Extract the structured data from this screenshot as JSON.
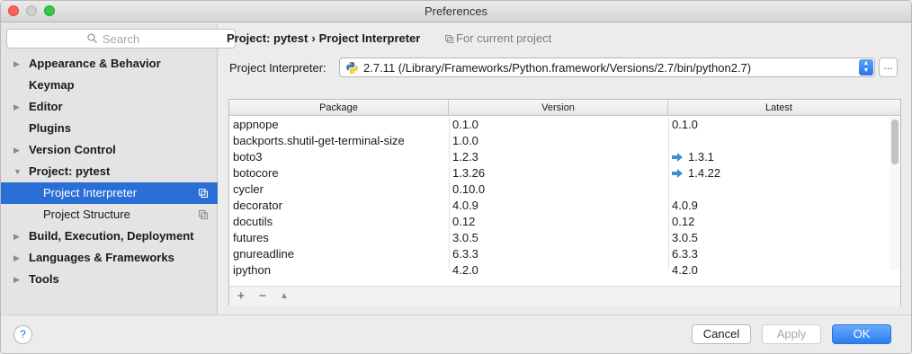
{
  "window": {
    "title": "Preferences"
  },
  "search": {
    "placeholder": "Search"
  },
  "sidebar": {
    "items": [
      {
        "label": "Appearance & Behavior",
        "arrow": "▶"
      },
      {
        "label": "Keymap",
        "arrow": ""
      },
      {
        "label": "Editor",
        "arrow": "▶"
      },
      {
        "label": "Plugins",
        "arrow": ""
      },
      {
        "label": "Version Control",
        "arrow": "▶"
      },
      {
        "label": "Project: pytest",
        "arrow": "▼"
      },
      {
        "label": "Project Interpreter",
        "arrow": ""
      },
      {
        "label": "Project Structure",
        "arrow": ""
      },
      {
        "label": "Build, Execution, Deployment",
        "arrow": "▶"
      },
      {
        "label": "Languages & Frameworks",
        "arrow": "▶"
      },
      {
        "label": "Tools",
        "arrow": "▶"
      }
    ]
  },
  "header": {
    "breadcrumb_parent": "Project: pytest",
    "breadcrumb_sep": "›",
    "breadcrumb_current": "Project Interpreter",
    "scope": "For current project"
  },
  "interpreter": {
    "label": "Project Interpreter:",
    "value": "2.7.11 (/Library/Frameworks/Python.framework/Versions/2.7/bin/python2.7)",
    "more_label": "..."
  },
  "table": {
    "headers": [
      "Package",
      "Version",
      "Latest"
    ],
    "rows": [
      {
        "package": "appnope",
        "version": "0.1.0",
        "latest": "0.1.0",
        "upgrade": false
      },
      {
        "package": "backports.shutil-get-terminal-size",
        "version": "1.0.0",
        "latest": "",
        "upgrade": false
      },
      {
        "package": "boto3",
        "version": "1.2.3",
        "latest": "1.3.1",
        "upgrade": true
      },
      {
        "package": "botocore",
        "version": "1.3.26",
        "latest": "1.4.22",
        "upgrade": true
      },
      {
        "package": "cycler",
        "version": "0.10.0",
        "latest": "",
        "upgrade": false
      },
      {
        "package": "decorator",
        "version": "4.0.9",
        "latest": "4.0.9",
        "upgrade": false
      },
      {
        "package": "docutils",
        "version": "0.12",
        "latest": "0.12",
        "upgrade": false
      },
      {
        "package": "futures",
        "version": "3.0.5",
        "latest": "3.0.5",
        "upgrade": false
      },
      {
        "package": "gnureadline",
        "version": "6.3.3",
        "latest": "6.3.3",
        "upgrade": false
      },
      {
        "package": "ipython",
        "version": "4.2.0",
        "latest": "4.2.0",
        "upgrade": false
      }
    ]
  },
  "table_toolbar": {
    "add": "+",
    "remove": "−",
    "upgrade": "▲"
  },
  "footer": {
    "help_label": "?",
    "cancel_label": "Cancel",
    "apply_label": "Apply",
    "ok_label": "OK"
  },
  "colors": {
    "selection": "#2a6fd6",
    "upgrade_arrow": "#3c8fd6",
    "ok_button": "#2a7ef0"
  },
  "icons": {
    "search": "search-icon",
    "copy": "copy-icon",
    "python": "python-icon",
    "upgrade": "upgrade-arrow-icon"
  }
}
